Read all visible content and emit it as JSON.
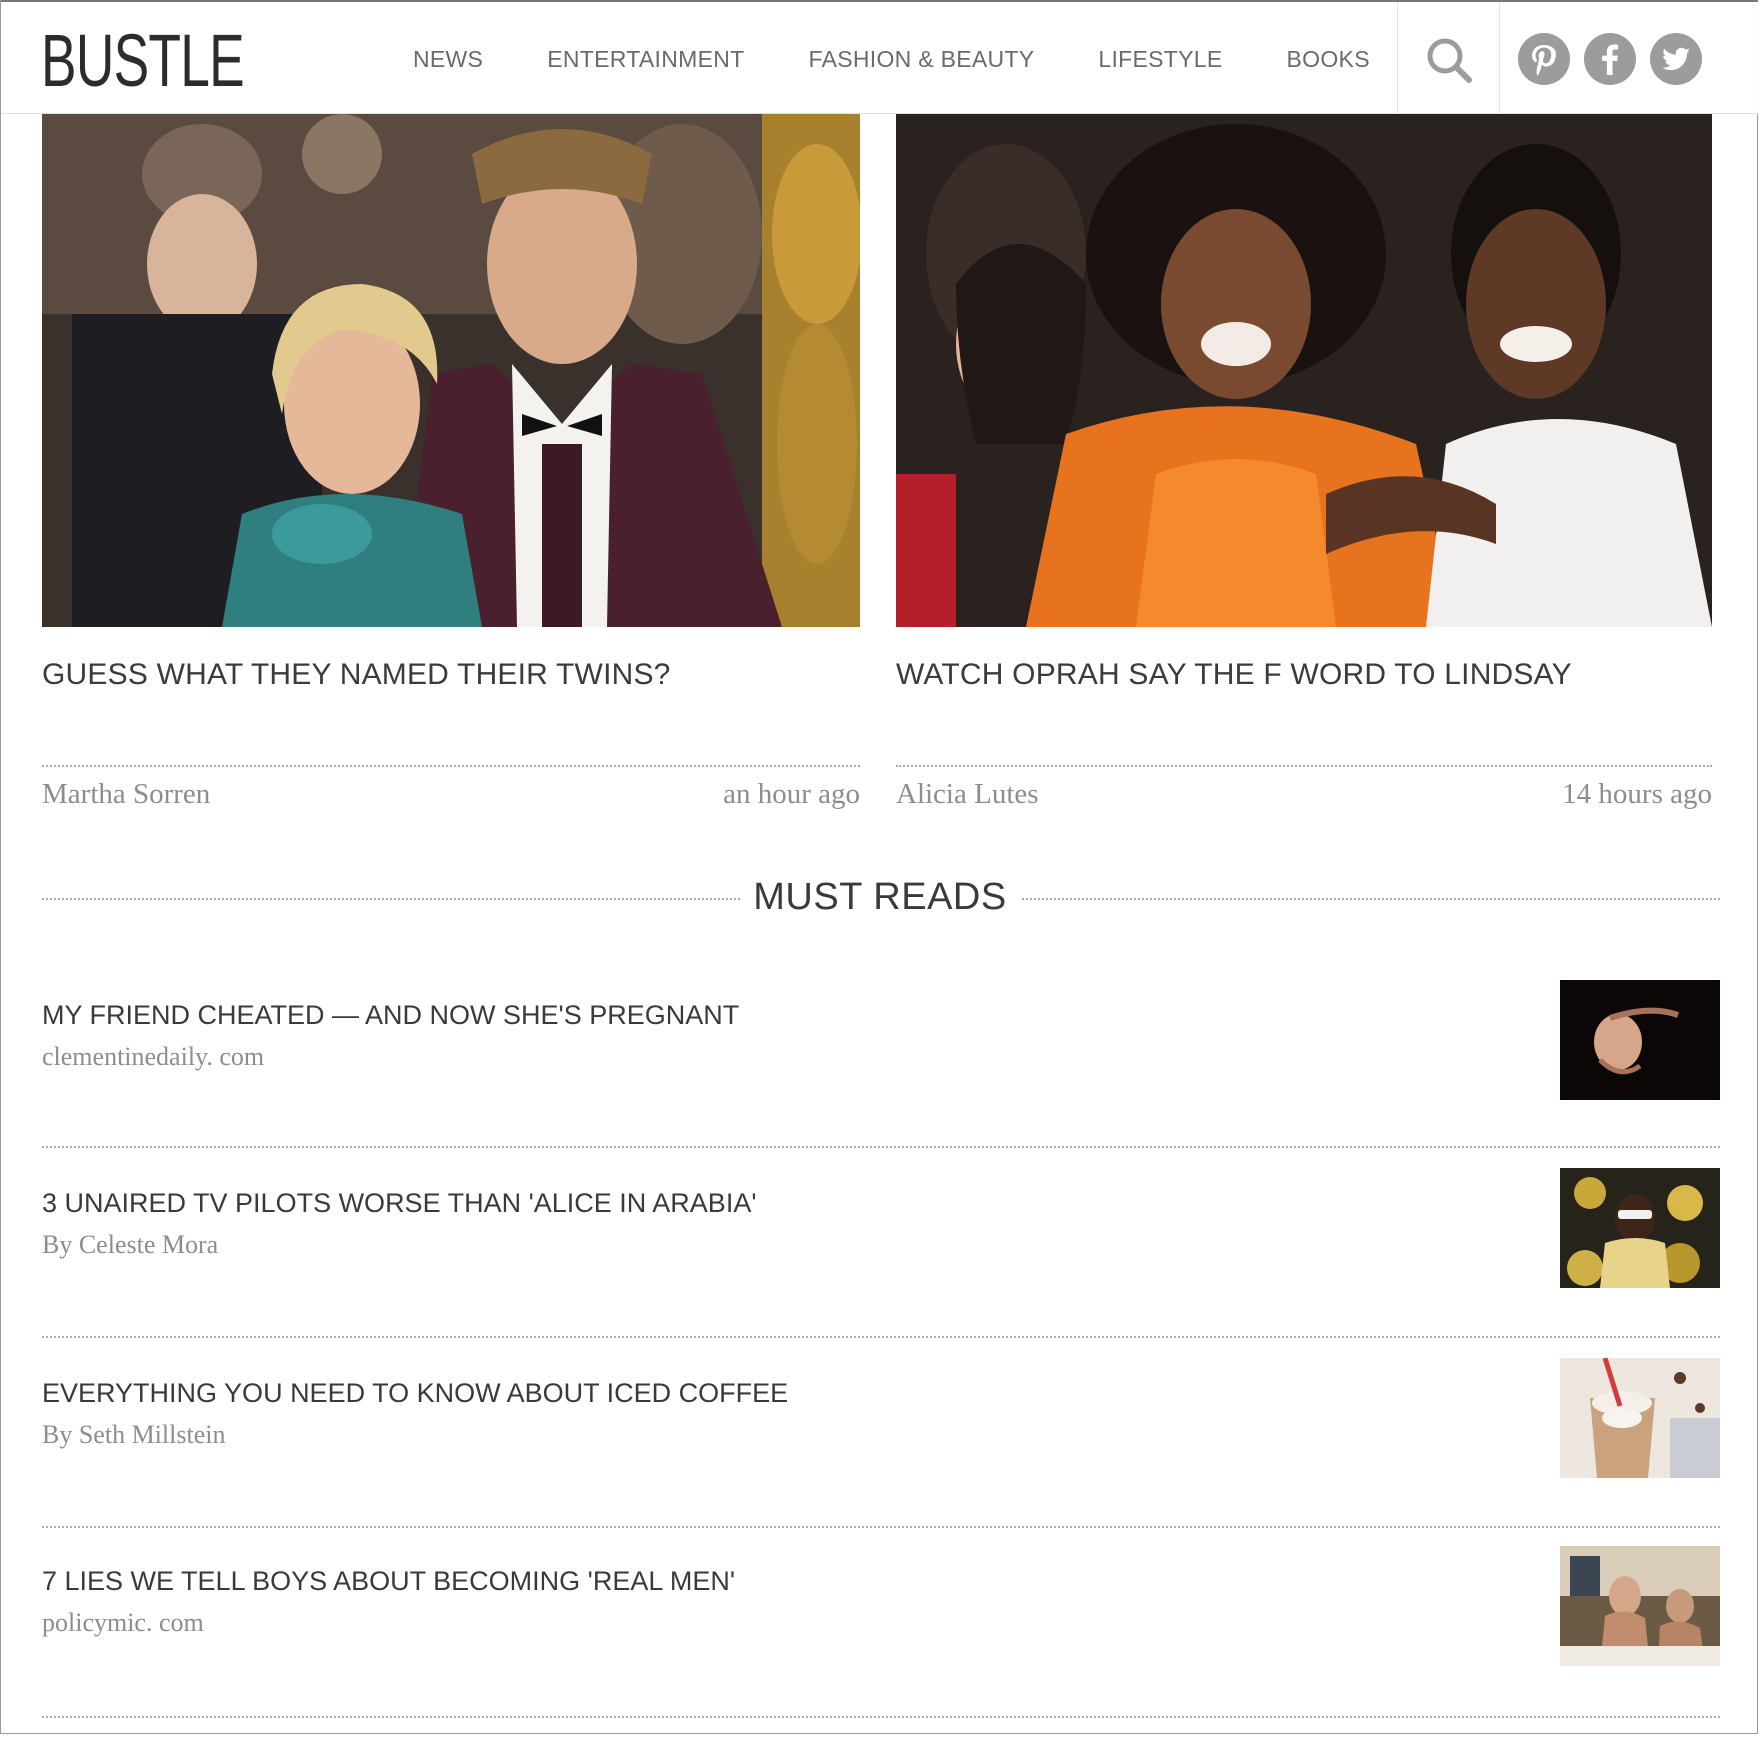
{
  "header": {
    "logo": "BUSTLE",
    "nav": [
      "NEWS",
      "ENTERTAINMENT",
      "FASHION & BEAUTY",
      "LIFESTYLE",
      "BOOKS"
    ],
    "icons": [
      "search-icon",
      "pinterest-icon",
      "facebook-icon",
      "twitter-icon"
    ]
  },
  "featured": [
    {
      "title": "GUESS WHAT THEY NAMED THEIR TWINS?",
      "author": "Martha Sorren",
      "time": "an hour ago"
    },
    {
      "title": "WATCH OPRAH SAY THE F WORD TO LINDSAY",
      "author": "Alicia Lutes",
      "time": "14 hours ago"
    }
  ],
  "must_reads": {
    "heading": "MUST READS",
    "items": [
      {
        "title": "MY FRIEND CHEATED — AND NOW SHE'S PREGNANT",
        "source": "clementinedaily. com"
      },
      {
        "title": "3 UNAIRED TV PILOTS WORSE THAN 'ALICE IN ARABIA'",
        "source": "By Celeste Mora"
      },
      {
        "title": "EVERYTHING YOU NEED TO KNOW ABOUT ICED COFFEE",
        "source": "By Seth Millstein"
      },
      {
        "title": "7 LIES WE TELL BOYS ABOUT BECOMING 'REAL MEN'",
        "source": "policymic. com"
      }
    ]
  },
  "colors": {
    "text": "#3a3a3a",
    "meta": "#8d8d8d",
    "icon": "#9c9c9c"
  }
}
